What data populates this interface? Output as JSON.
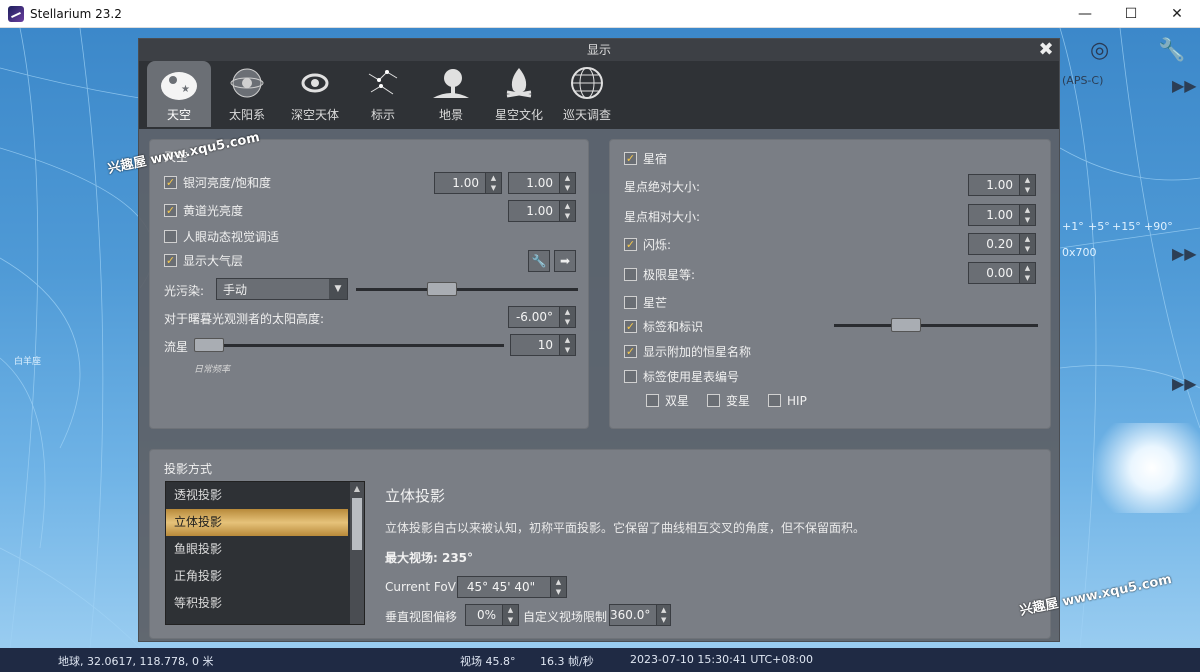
{
  "window": {
    "title": "Stellarium 23.2",
    "minimize": "—",
    "maximize": "☐",
    "close": "✕"
  },
  "dialog": {
    "title": "显示",
    "close": "✖",
    "tabs": [
      {
        "label": "天空",
        "icon": "sky-icon"
      },
      {
        "label": "太阳系",
        "icon": "solar-system-icon"
      },
      {
        "label": "深空天体",
        "icon": "galaxy-icon"
      },
      {
        "label": "标示",
        "icon": "markings-icon"
      },
      {
        "label": "地景",
        "icon": "landscape-icon"
      },
      {
        "label": "星空文化",
        "icon": "starlore-icon"
      },
      {
        "label": "巡天调查",
        "icon": "survey-icon"
      }
    ]
  },
  "sky_panel": {
    "title": "天空",
    "milky_way": {
      "label": "银河亮度/饱和度",
      "checked": true,
      "brightness": "1.00",
      "saturation": "1.00"
    },
    "zodiacal": {
      "label": "黄道光亮度",
      "checked": true,
      "value": "1.00"
    },
    "eye_adapt": {
      "label": "人眼动态视觉调适",
      "checked": false
    },
    "atmosphere": {
      "label": "显示大气层",
      "checked": true
    },
    "light_pollution": {
      "label": "光污染:",
      "value": "手动",
      "slider": 0.37
    },
    "sun_altitude": {
      "label": "对于曙暮光观测者的太阳高度:",
      "value": "-6.00°"
    },
    "meteors": {
      "label": "流星",
      "value": "10",
      "slider": 0.0,
      "sublabel": "日常频率"
    }
  },
  "stars_panel": {
    "title": "星宿",
    "checked": true,
    "absolute_scale": {
      "label": "星点绝对大小:",
      "value": "1.00"
    },
    "relative_scale": {
      "label": "星点相对大小:",
      "value": "1.00"
    },
    "twinkle": {
      "label": "闪烁:",
      "checked": true,
      "value": "0.20"
    },
    "limit_magnitude": {
      "label": "极限星等:",
      "checked": false,
      "value": "0.00"
    },
    "spikes": {
      "label": "星芒",
      "checked": false
    },
    "labels": {
      "label": "标签和标识",
      "checked": true,
      "slider": 0.33
    },
    "additional_names": {
      "label": "显示附加的恒星名称",
      "checked": true
    },
    "catalog_numbers": {
      "label": "标签使用星表编号",
      "checked": false
    },
    "double": {
      "label": "双星",
      "checked": false
    },
    "variable": {
      "label": "变星",
      "checked": false
    },
    "hip": {
      "label": "HIP",
      "checked": false
    }
  },
  "projection_panel": {
    "title": "投影方式",
    "items": [
      "透视投影",
      "立体投影",
      "鱼眼投影",
      "正角投影",
      "等积投影"
    ],
    "selected": 1,
    "detail_title": "立体投影",
    "description": "立体投影自古以来被认知，初称平面投影。它保留了曲线相互交叉的角度，但不保留面积。",
    "max_fov": "最大视场: 235°",
    "current_fov_label": "Current FoV",
    "current_fov_value": "45° 45' 40\"",
    "vertical_offset_label": "垂直视图偏移",
    "vertical_offset_value": "0%",
    "custom_fov_label": "自定义视场限制",
    "custom_fov_value": "360.0°"
  },
  "background_overlay": {
    "sky_labels": [
      "+1°",
      "+5°",
      "+15°",
      "+90°",
      "0x700",
      "(APS-C)"
    ],
    "object_label": "白羊座"
  },
  "statusbar": {
    "location": "地球, 32.0617, 118.778, 0 米",
    "fov": "视场 45.8°",
    "fps": "16.3 帧/秒",
    "datetime": "2023-07-10 15:30:41 UTC+08:00"
  },
  "watermarks": [
    "兴趣屋 www.xqu5.com",
    "兴趣屋 www.xqu5.com"
  ]
}
